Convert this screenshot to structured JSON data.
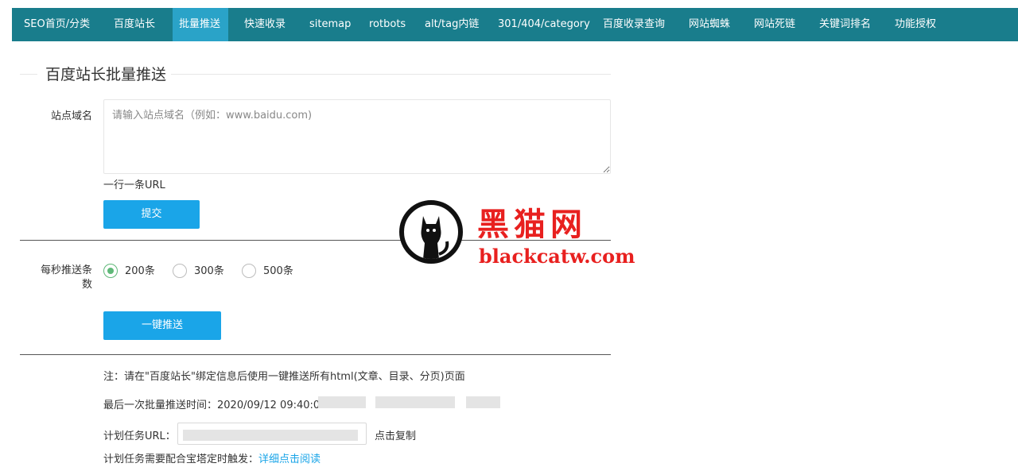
{
  "nav": {
    "items": [
      {
        "label": "SEO首页/分类",
        "active": false
      },
      {
        "label": "百度站长",
        "active": false
      },
      {
        "label": "批量推送",
        "active": true
      },
      {
        "label": "快速收录",
        "active": false
      },
      {
        "label": "sitemap",
        "active": false
      },
      {
        "label": "rotbots",
        "active": false
      },
      {
        "label": "alt/tag内链",
        "active": false
      },
      {
        "label": "301/404/category",
        "active": false
      },
      {
        "label": "百度收录查询",
        "active": false
      },
      {
        "label": "网站蜘蛛",
        "active": false
      },
      {
        "label": "网站死链",
        "active": false
      },
      {
        "label": "关键词排名",
        "active": false
      },
      {
        "label": "功能授权",
        "active": false
      }
    ]
  },
  "form": {
    "section_title": "百度站长批量推送",
    "domain_label": "站点域名",
    "domain_placeholder": "请输入站点域名（例如：www.baidu.com)",
    "domain_value": "",
    "line_hint": "一行一条URL",
    "submit_label": "提交",
    "rate_label": "每秒推送条数",
    "rate_options": [
      {
        "label": "200条",
        "checked": true
      },
      {
        "label": "300条",
        "checked": false
      },
      {
        "label": "500条",
        "checked": false
      }
    ],
    "push_all_label": "一键推送"
  },
  "notes": {
    "note_text": "注：请在\"百度站长\"绑定信息后使用一键推送所有html(文章、目录、分页)页面",
    "last_push_label": "最后一次批量推送时间：2020/09/12 09:40:01",
    "task_url_label": "计划任务URL：",
    "copy_label": "点击复制",
    "cron_text": "计划任务需要配合宝塔定时触发：",
    "read_more_label": "详细点击阅读"
  },
  "watermark": {
    "cn_text": "黑猫网",
    "en_text": "blackcatw.com"
  },
  "colors": {
    "nav_bg": "#197d8c",
    "nav_active": "#2aa3c8",
    "primary_button": "#1aa5e8",
    "radio_checked": "#5fb878",
    "watermark_red": "#e8201f"
  }
}
